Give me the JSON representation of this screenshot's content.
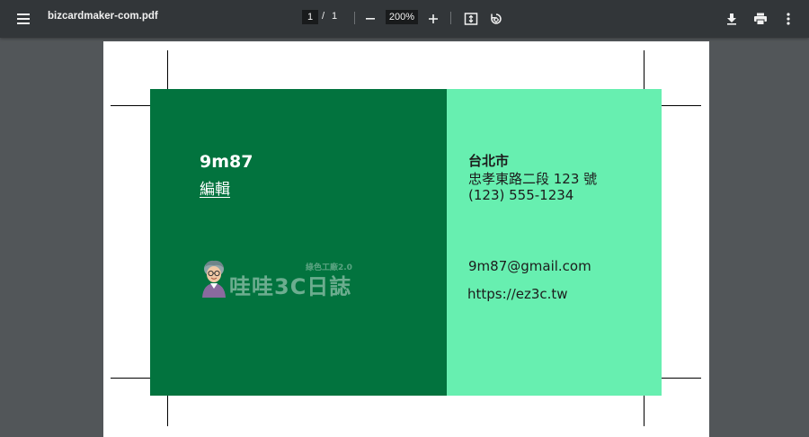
{
  "toolbar": {
    "title": "bizcardmaker-com.pdf",
    "page_current": "1",
    "page_separator": "/",
    "page_total": "1",
    "zoom": "200%",
    "icons": [
      "menu-icon",
      "zoom-out-icon",
      "zoom-in-icon",
      "fit-page-icon",
      "rotate-icon",
      "download-icon",
      "print-icon",
      "more-icon"
    ],
    "colors": {
      "toolbar_bg": "#323639",
      "viewer_bg": "#525659"
    }
  },
  "card": {
    "name": "9m87",
    "role": "編輯",
    "address": {
      "city": "台北市",
      "street": "忠孝東路二段 123 號",
      "phone": "(123) 555-1234"
    },
    "email": "9m87@gmail.com",
    "website": "https://ez3c.tw",
    "colors": {
      "left": "#02733e",
      "right": "#67efb0"
    }
  },
  "watermark": {
    "text": "哇哇3C日誌",
    "subtext": "綠色工廠2.0"
  }
}
